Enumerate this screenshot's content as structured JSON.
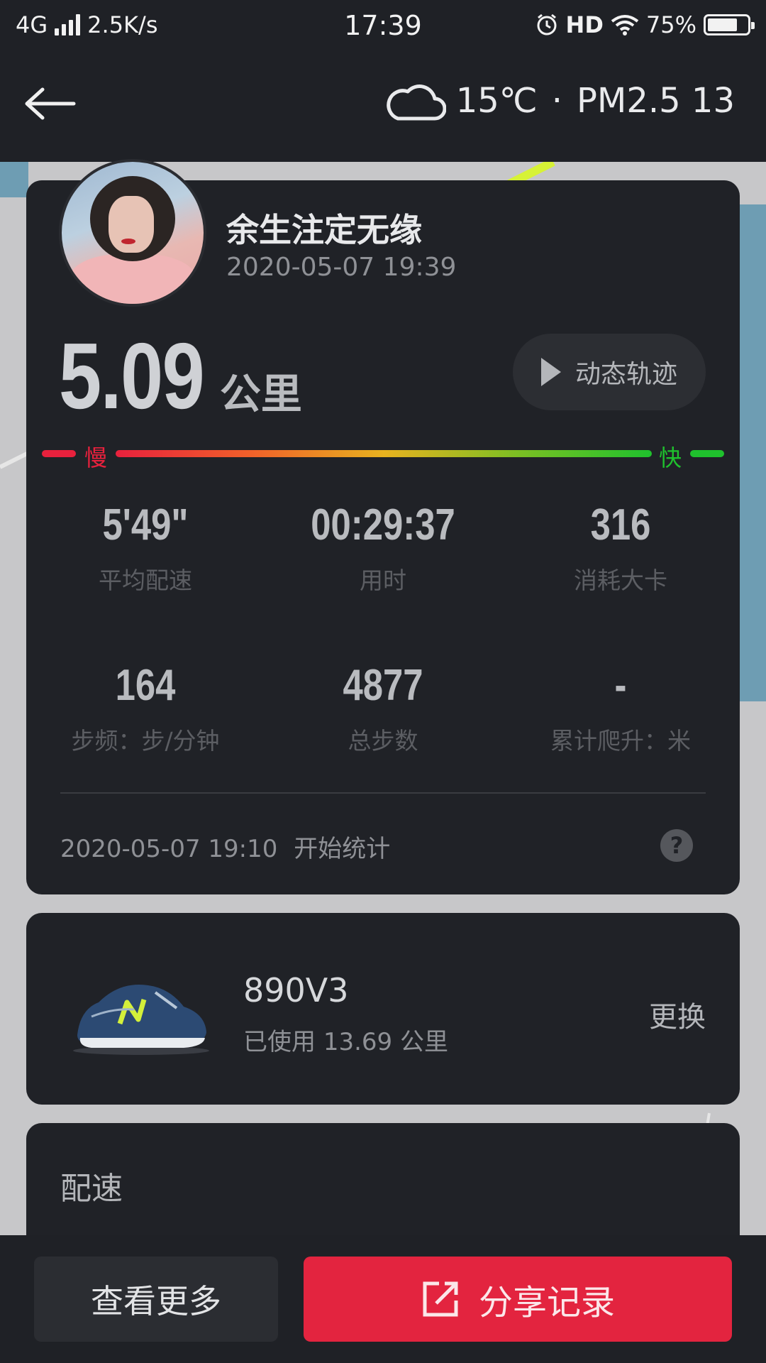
{
  "status_bar": {
    "network": "4G",
    "speed": "2.5K/s",
    "time": "17:39",
    "hd": "HD",
    "battery": "75%",
    "battery_level": 0.75
  },
  "header": {
    "weather_temp": "15℃",
    "separator": "·",
    "pm25": "PM2.5 13"
  },
  "record": {
    "user_name": "余生注定无缘",
    "record_time": "2020-05-07 19:39",
    "distance": "5.09",
    "distance_unit": "公里",
    "replay_label": "动态轨迹",
    "slow_label": "慢",
    "fast_label": "快",
    "stats_row1": [
      {
        "value": "5'49\"",
        "label": "平均配速"
      },
      {
        "value": "00:29:37",
        "label": "用时"
      },
      {
        "value": "316",
        "label": "消耗大卡"
      }
    ],
    "stats_row2": [
      {
        "value": "164",
        "label": "步频：步/分钟"
      },
      {
        "value": "4877",
        "label": "总步数"
      },
      {
        "value": "-",
        "label": "累计爬升：米"
      }
    ],
    "start_time": "2020-05-07 19:10",
    "start_label": "开始统计",
    "help": "?"
  },
  "shoe": {
    "name": "890V3",
    "usage_prefix": "已使用",
    "usage_value": "13.69",
    "usage_unit": "公里",
    "change_label": "更换"
  },
  "pace": {
    "title": "配速"
  },
  "bottom": {
    "more_label": "查看更多",
    "share_label": "分享记录"
  },
  "colors": {
    "accent_red": "#e3243f",
    "slow_red": "#e8213d",
    "fast_green": "#1fc12d"
  }
}
